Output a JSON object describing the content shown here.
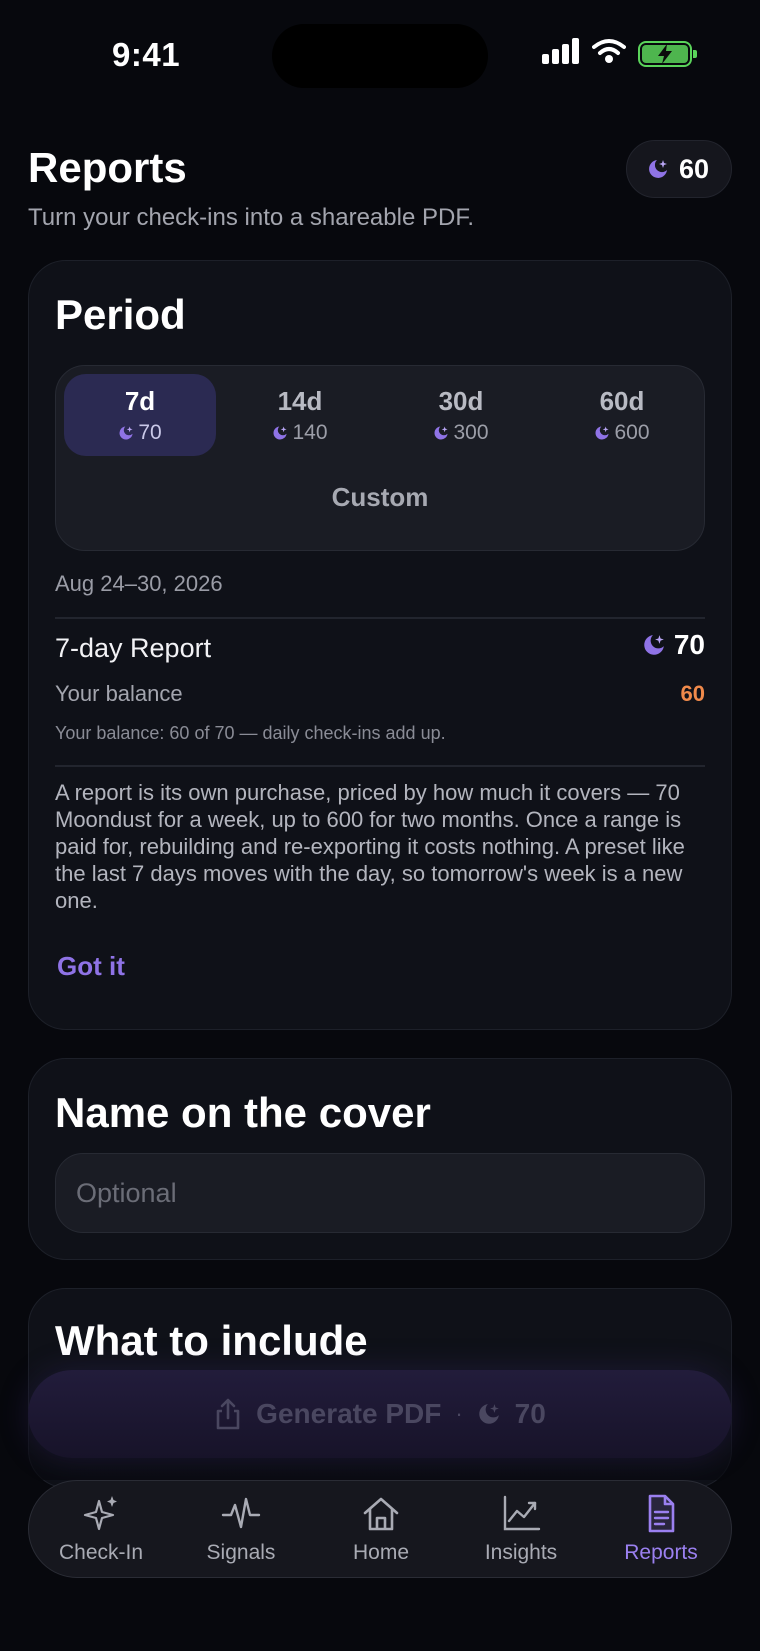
{
  "status": {
    "time": "9:41"
  },
  "header": {
    "title": "Reports",
    "subtitle": "Turn your check-ins into a shareable PDF.",
    "balance": "60"
  },
  "period": {
    "title": "Period",
    "options": [
      {
        "label": "7d",
        "cost": "70",
        "selected": true
      },
      {
        "label": "14d",
        "cost": "140",
        "selected": false
      },
      {
        "label": "30d",
        "cost": "300",
        "selected": false
      },
      {
        "label": "60d",
        "cost": "600",
        "selected": false
      }
    ],
    "custom_label": "Custom",
    "date_range": "Aug 24–30, 2026",
    "report_name": "7-day Report",
    "report_price": "70",
    "balance_label": "Your balance",
    "balance_value": "60",
    "balance_note": "Your balance: 60 of 70 — daily check-ins add up.",
    "explanation": "A report is its own purchase, priced by how much it covers — 70 Moondust for a week, up to 600 for two months. Once a range is paid for, rebuilding and re-exporting it costs nothing. A preset like the last 7 days moves with the day, so tomorrow's week is a new one.",
    "dismiss_label": "Got it"
  },
  "cover": {
    "title": "Name on the cover",
    "placeholder": "Optional"
  },
  "include": {
    "title": "What to include"
  },
  "generate": {
    "label": "Generate PDF",
    "separator": "·",
    "cost": "70"
  },
  "tabs": [
    {
      "label": "Check-In",
      "icon": "sparkles-icon",
      "active": false
    },
    {
      "label": "Signals",
      "icon": "pulse-icon",
      "active": false
    },
    {
      "label": "Home",
      "icon": "house-icon",
      "active": false
    },
    {
      "label": "Insights",
      "icon": "chart-line-icon",
      "active": false
    },
    {
      "label": "Reports",
      "icon": "document-icon",
      "active": true
    }
  ],
  "colors": {
    "accent": "#8f73e6",
    "warning": "#f08a4b",
    "background": "#07080d"
  }
}
